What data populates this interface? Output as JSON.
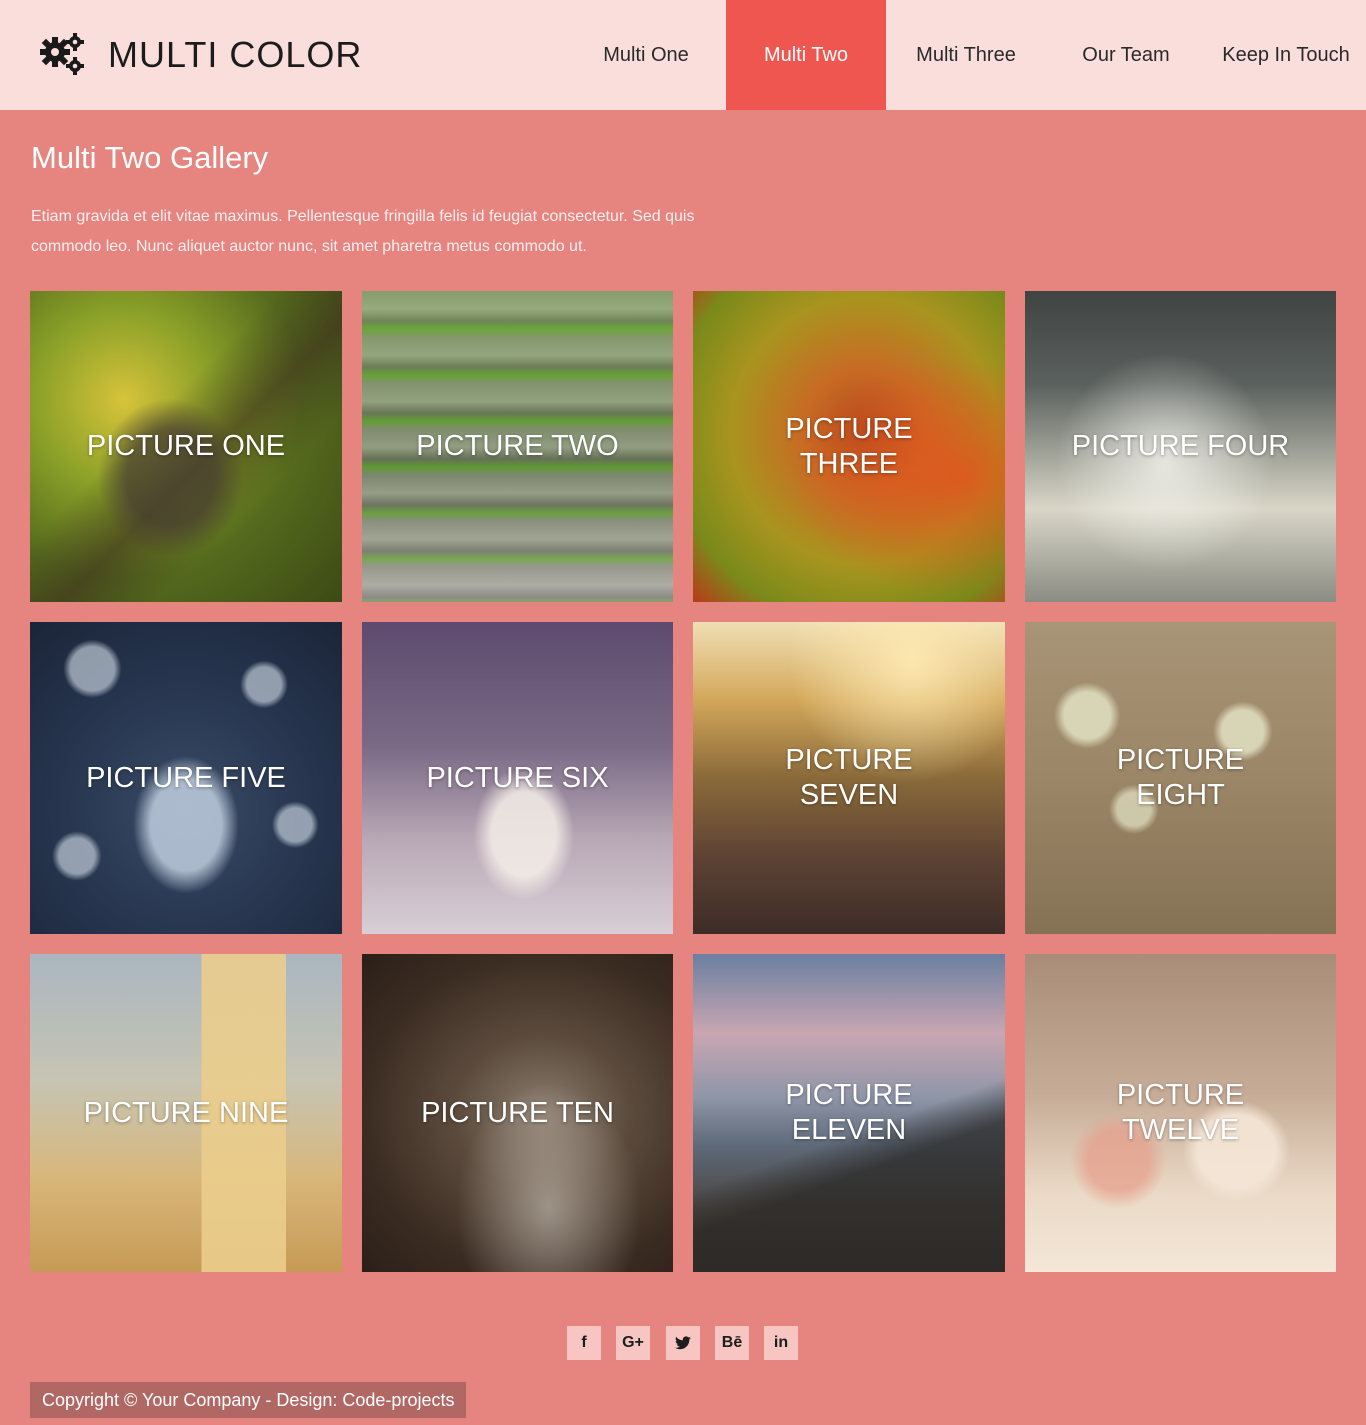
{
  "brand": {
    "title": "MULTI COLOR",
    "icon": "gears-icon"
  },
  "nav": [
    {
      "label": "Multi One",
      "active": false
    },
    {
      "label": "Multi Two",
      "active": true
    },
    {
      "label": "Multi Three",
      "active": false
    },
    {
      "label": "Our Team",
      "active": false
    },
    {
      "label": "Keep In Touch",
      "active": false
    }
  ],
  "main": {
    "title": "Multi Two Gallery",
    "intro": "Etiam gravida et elit vitae maximus. Pellentesque fringilla felis id feugiat consectetur. Sed quis commodo leo. Nunc aliquet auctor nunc, sit amet pharetra metus commodo ut."
  },
  "gallery": [
    {
      "label": "PICTURE ONE"
    },
    {
      "label": "PICTURE TWO"
    },
    {
      "label": "PICTURE THREE"
    },
    {
      "label": "PICTURE FOUR"
    },
    {
      "label": "PICTURE FIVE"
    },
    {
      "label": "PICTURE SIX"
    },
    {
      "label": "PICTURE SEVEN"
    },
    {
      "label": "PICTURE EIGHT"
    },
    {
      "label": "PICTURE NINE"
    },
    {
      "label": "PICTURE TEN"
    },
    {
      "label": "PICTURE ELEVEN"
    },
    {
      "label": "PICTURE TWELVE"
    }
  ],
  "social": [
    {
      "label": "f",
      "icon": "facebook-icon"
    },
    {
      "label": "G+",
      "icon": "google-plus-icon"
    },
    {
      "label": "t",
      "icon": "twitter-icon"
    },
    {
      "label": "Bē",
      "icon": "behance-icon"
    },
    {
      "label": "in",
      "icon": "linkedin-icon"
    }
  ],
  "footer": {
    "copyright": "Copyright © Your Company - Design: Code-projects"
  },
  "colors": {
    "background": "#e6847f",
    "header": "#f9dedb",
    "nav_active": "#ee564f",
    "social_button": "#f7c6c3",
    "copyright_bar": "#b16864"
  }
}
